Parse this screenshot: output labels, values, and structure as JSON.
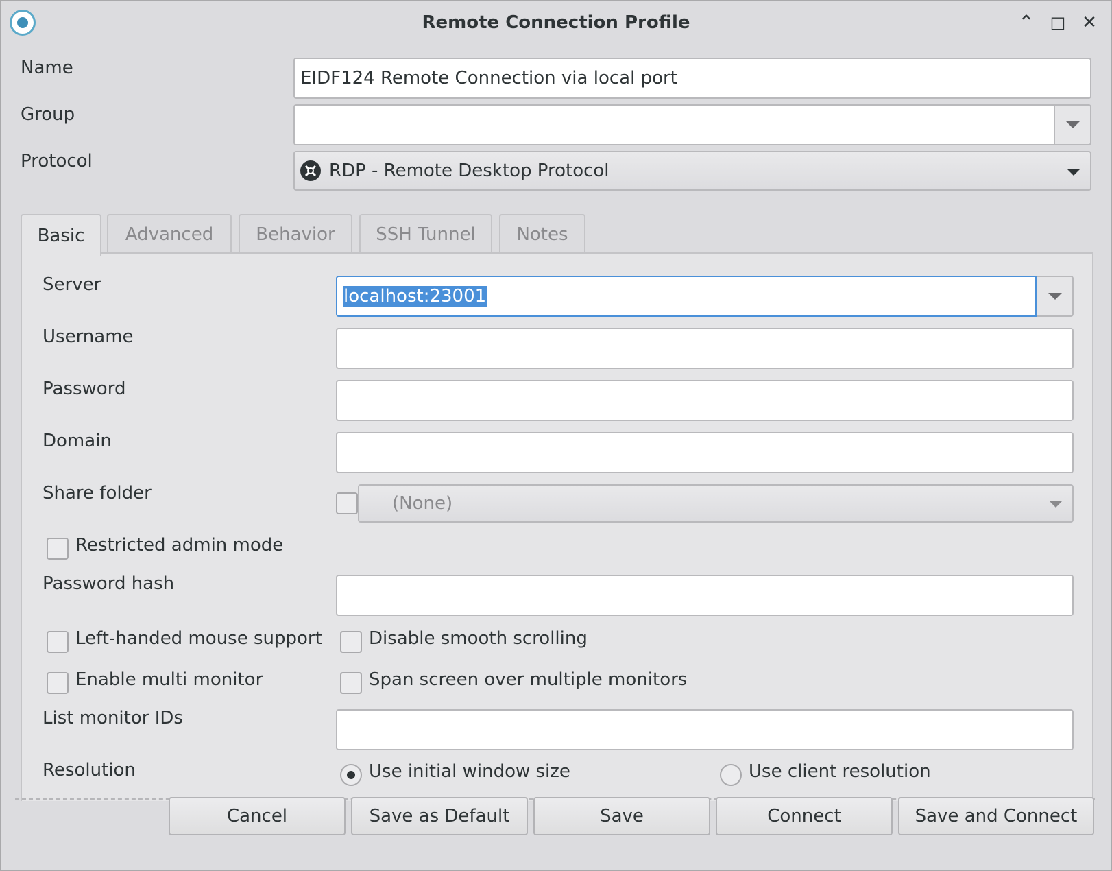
{
  "window": {
    "title": "Remote Connection Profile",
    "controls": {
      "minimize": "⌃",
      "maximize": "□",
      "close": "✕"
    }
  },
  "profile": {
    "name_label": "Name",
    "name_value": "EIDF124 Remote Connection via local port",
    "group_label": "Group",
    "group_value": "",
    "protocol_label": "Protocol",
    "protocol_value": "RDP - Remote Desktop Protocol"
  },
  "tabs": [
    {
      "label": "Basic",
      "active": true
    },
    {
      "label": "Advanced",
      "active": false
    },
    {
      "label": "Behavior",
      "active": false
    },
    {
      "label": "SSH Tunnel",
      "active": false
    },
    {
      "label": "Notes",
      "active": false
    }
  ],
  "basic": {
    "server_label": "Server",
    "server_value": "localhost:23001",
    "username_label": "Username",
    "username_value": "",
    "password_label": "Password",
    "password_value": "",
    "domain_label": "Domain",
    "domain_value": "",
    "share_folder_label": "Share folder",
    "share_folder_value": "(None)",
    "restricted_admin_label": "Restricted admin mode",
    "password_hash_label": "Password hash",
    "password_hash_value": "",
    "left_handed_label": "Left-handed mouse support",
    "disable_smooth_label": "Disable smooth scrolling",
    "multi_monitor_label": "Enable multi monitor",
    "span_screen_label": "Span screen over multiple monitors",
    "list_monitor_label": "List monitor IDs",
    "list_monitor_value": "",
    "resolution_label": "Resolution",
    "resolution_option_initial": "Use initial window size",
    "resolution_option_client": "Use client resolution",
    "resolution_selected": "Use initial window size"
  },
  "buttons": {
    "cancel": "Cancel",
    "save_default": "Save as Default",
    "save": "Save",
    "connect": "Connect",
    "save_connect": "Save and Connect"
  },
  "colors": {
    "selection": "#4a90d9",
    "window_bg": "#dcdcdf",
    "accent_icon": "#5aa9c9"
  }
}
